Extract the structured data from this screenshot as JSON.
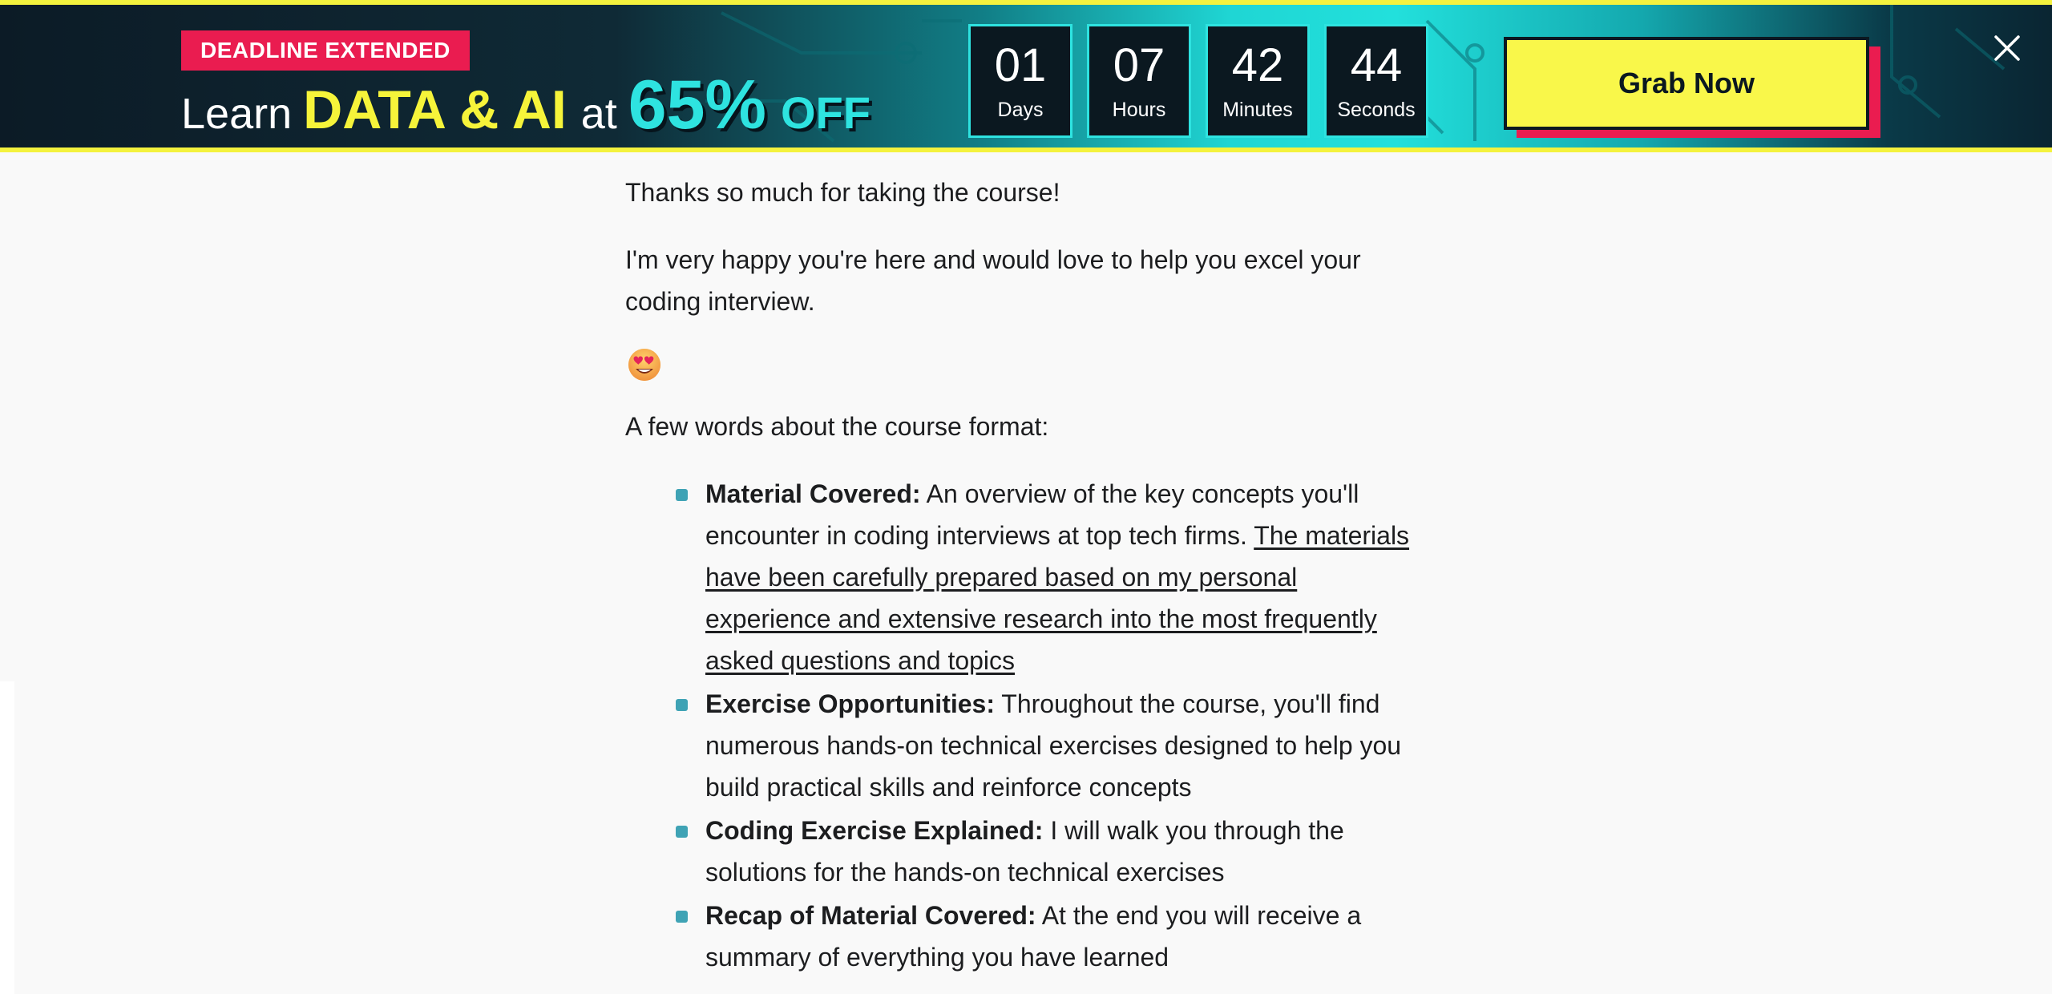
{
  "banner": {
    "badge": "DEADLINE EXTENDED",
    "headline": {
      "learn": "Learn",
      "subject": "DATA & AI",
      "at": "at",
      "percent": "65%",
      "off": "OFF"
    },
    "countdown": [
      {
        "value": "01",
        "label": "Days"
      },
      {
        "value": "07",
        "label": "Hours"
      },
      {
        "value": "42",
        "label": "Minutes"
      },
      {
        "value": "44",
        "label": "Seconds"
      }
    ],
    "cta_label": "Grab Now",
    "colors": {
      "accent_yellow": "#f4f23e",
      "accent_cyan": "#2ee3e0",
      "badge_red": "#ea1c50"
    },
    "close_icon": "close-icon"
  },
  "article": {
    "thanks": "Thanks so much for taking the course!",
    "happy": "I'm very happy you're here  and would love to help you excel your coding interview.",
    "emoji_icon": "heart-eyes-emoji-icon",
    "format_intro": "A few words about the course format:",
    "items": [
      {
        "title": "Material Covered:",
        "text": " An overview of the key concepts you'll encounter in coding interviews at top tech firms. ",
        "link": "The materials have been carefully prepared based on my personal experience and extensive research into the most frequently asked questions and topics"
      },
      {
        "title": "Exercise Opportunities:",
        "text": " Throughout the course, you'll find numerous hands-on technical exercises designed to help you build practical skills and reinforce concepts"
      },
      {
        "title": "Coding Exercise Explained:",
        "text": " I will walk you through the solutions for the hands-on technical exercises"
      },
      {
        "title": "Recap of Material Covered:",
        "text": " At the end you will receive a summary of everything you have learned"
      }
    ]
  }
}
